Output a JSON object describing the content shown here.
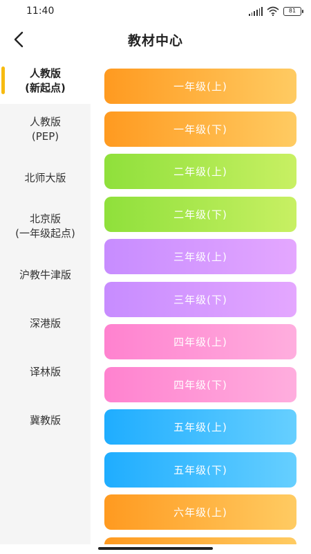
{
  "status_bar": {
    "time": "11:40",
    "battery": "81"
  },
  "header": {
    "title": "教材中心"
  },
  "sidebar": {
    "items": [
      {
        "line1": "人教版",
        "line2": "(新起点)",
        "active": true
      },
      {
        "line1": "人教版",
        "line2": "(PEP)",
        "active": false
      },
      {
        "line1": "北师大版",
        "line2": "",
        "active": false
      },
      {
        "line1": "北京版",
        "line2": "(一年级起点)",
        "active": false
      },
      {
        "line1": "沪教牛津版",
        "line2": "",
        "active": false
      },
      {
        "line1": "深港版",
        "line2": "",
        "active": false
      },
      {
        "line1": "译林版",
        "line2": "",
        "active": false
      },
      {
        "line1": "冀教版",
        "line2": "",
        "active": false
      }
    ]
  },
  "grades": [
    {
      "label": "一年级(上)",
      "color": "orange"
    },
    {
      "label": "一年级(下)",
      "color": "orange"
    },
    {
      "label": "二年级(上)",
      "color": "green"
    },
    {
      "label": "二年级(下)",
      "color": "green"
    },
    {
      "label": "三年级(上)",
      "color": "purple"
    },
    {
      "label": "三年级(下)",
      "color": "purple"
    },
    {
      "label": "四年级(上)",
      "color": "pink"
    },
    {
      "label": "四年级(下)",
      "color": "pink"
    },
    {
      "label": "五年级(上)",
      "color": "blue"
    },
    {
      "label": "五年级(下)",
      "color": "blue"
    },
    {
      "label": "六年级(上)",
      "color": "orange"
    },
    {
      "label": "",
      "color": "orange"
    }
  ],
  "colors": {
    "accent": "#f7bb10",
    "orange": "#ff9a20",
    "green": "#8fe03b",
    "purple": "#c78cff",
    "pink": "#ff82cf",
    "blue": "#1fadff"
  }
}
